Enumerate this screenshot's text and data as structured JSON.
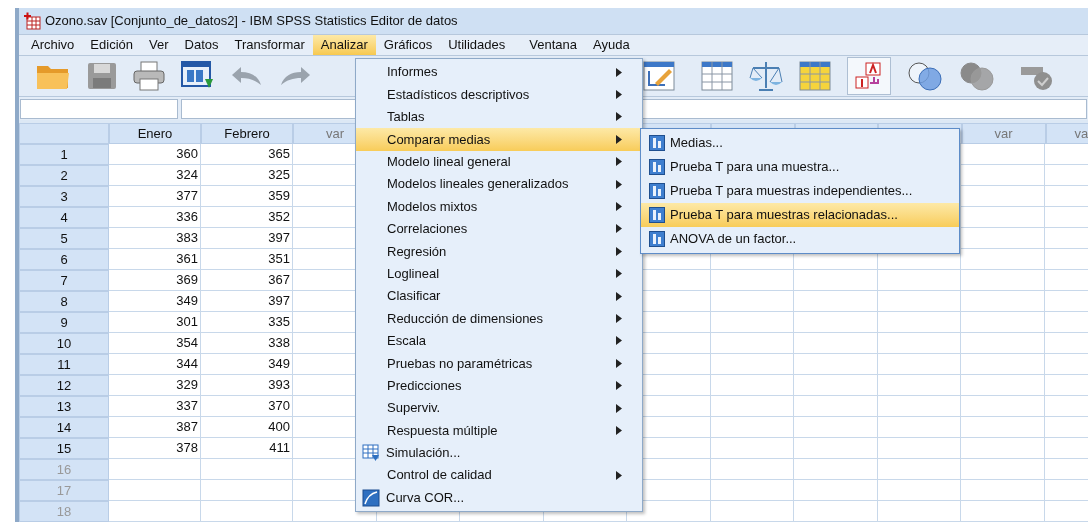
{
  "window": {
    "title": "Ozono.sav [Conjunto_de_datos2] - IBM SPSS Statistics Editor de datos"
  },
  "menu_bar": [
    {
      "label": "Archivo",
      "selected": false
    },
    {
      "label": "Edición",
      "selected": false
    },
    {
      "label": "Ver",
      "selected": false
    },
    {
      "label": "Datos",
      "selected": false
    },
    {
      "label": "Transformar",
      "selected": false
    },
    {
      "label": "Analizar",
      "selected": true
    },
    {
      "label": "Gráficos",
      "selected": false
    },
    {
      "label": "Utilidades",
      "selected": false
    },
    {
      "label": "Ventana",
      "selected": false
    },
    {
      "label": "Ayuda",
      "selected": false
    }
  ],
  "grid": {
    "columns": [
      {
        "label": "Enero"
      },
      {
        "label": "Febrero"
      },
      {
        "label": "var"
      },
      {
        "label": "var"
      },
      {
        "label": "va"
      }
    ],
    "rows": [
      {
        "number": "1",
        "cells": [
          "360",
          "365"
        ],
        "disabled": false
      },
      {
        "number": "2",
        "cells": [
          "324",
          "325"
        ],
        "disabled": false
      },
      {
        "number": "3",
        "cells": [
          "377",
          "359"
        ],
        "disabled": false
      },
      {
        "number": "4",
        "cells": [
          "336",
          "352"
        ],
        "disabled": false
      },
      {
        "number": "5",
        "cells": [
          "383",
          "397"
        ],
        "disabled": false
      },
      {
        "number": "6",
        "cells": [
          "361",
          "351"
        ],
        "disabled": false
      },
      {
        "number": "7",
        "cells": [
          "369",
          "367"
        ],
        "disabled": false
      },
      {
        "number": "8",
        "cells": [
          "349",
          "397"
        ],
        "disabled": false
      },
      {
        "number": "9",
        "cells": [
          "301",
          "335"
        ],
        "disabled": false
      },
      {
        "number": "10",
        "cells": [
          "354",
          "338"
        ],
        "disabled": false
      },
      {
        "number": "11",
        "cells": [
          "344",
          "349"
        ],
        "disabled": false
      },
      {
        "number": "12",
        "cells": [
          "329",
          "393"
        ],
        "disabled": false
      },
      {
        "number": "13",
        "cells": [
          "337",
          "370"
        ],
        "disabled": false
      },
      {
        "number": "14",
        "cells": [
          "387",
          "400"
        ],
        "disabled": false
      },
      {
        "number": "15",
        "cells": [
          "378",
          "411"
        ],
        "disabled": false
      },
      {
        "number": "16",
        "cells": [],
        "disabled": true
      },
      {
        "number": "17",
        "cells": [],
        "disabled": true
      },
      {
        "number": "18",
        "cells": [],
        "disabled": true
      }
    ]
  },
  "analyze_menu": [
    {
      "label": "Informes",
      "kind": "submenu",
      "selected": false
    },
    {
      "label": "Estadísticos descriptivos",
      "kind": "submenu",
      "selected": false
    },
    {
      "label": "Tablas",
      "kind": "submenu",
      "selected": false
    },
    {
      "label": "Comparar medias",
      "kind": "submenu",
      "selected": true
    },
    {
      "label": "Modelo lineal general",
      "kind": "submenu",
      "selected": false
    },
    {
      "label": "Modelos lineales generalizados",
      "kind": "submenu",
      "selected": false
    },
    {
      "label": "Modelos mixtos",
      "kind": "submenu",
      "selected": false
    },
    {
      "label": "Correlaciones",
      "kind": "submenu",
      "selected": false
    },
    {
      "label": "Regresión",
      "kind": "submenu",
      "selected": false
    },
    {
      "label": "Loglineal",
      "kind": "submenu",
      "selected": false
    },
    {
      "label": "Clasificar",
      "kind": "submenu",
      "selected": false
    },
    {
      "label": "Reducción de dimensiones",
      "kind": "submenu",
      "selected": false
    },
    {
      "label": "Escala",
      "kind": "submenu",
      "selected": false
    },
    {
      "label": "Pruebas no paramétricas",
      "kind": "submenu",
      "selected": false
    },
    {
      "label": "Predicciones",
      "kind": "submenu",
      "selected": false
    },
    {
      "label": "Superviv.",
      "kind": "submenu",
      "selected": false
    },
    {
      "label": "Respuesta múltiple",
      "kind": "submenu",
      "selected": false
    },
    {
      "label": "Simulación...",
      "kind": "action",
      "selected": false
    },
    {
      "label": "Control de calidad",
      "kind": "submenu",
      "selected": false
    },
    {
      "label": "Curva COR...",
      "kind": "action",
      "selected": false
    }
  ],
  "compare_means_menu": [
    {
      "label": "Medias...",
      "selected": false
    },
    {
      "label": "Prueba T para una muestra...",
      "selected": false
    },
    {
      "label": "Prueba T para muestras independientes...",
      "selected": false
    },
    {
      "label": "Prueba T para muestras relacionadas...",
      "selected": true
    },
    {
      "label": "ANOVA de un factor...",
      "selected": false
    }
  ]
}
